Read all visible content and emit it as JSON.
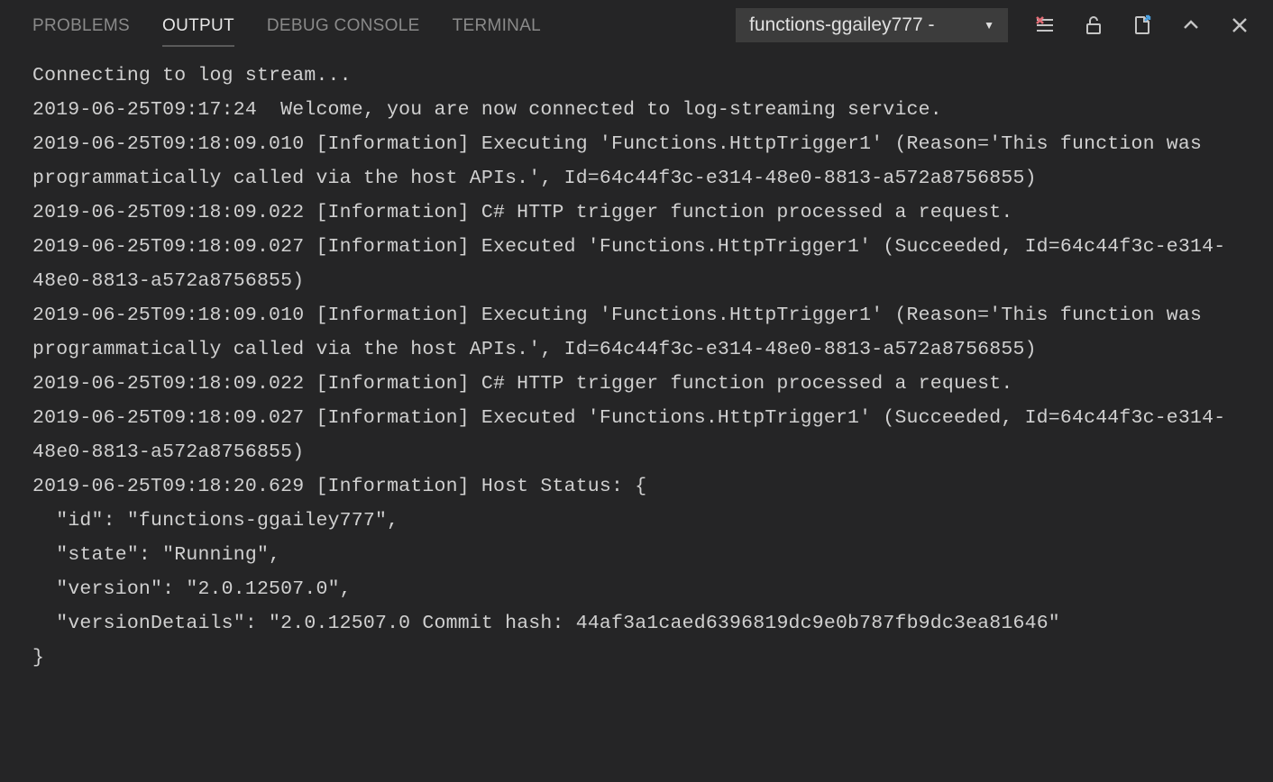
{
  "tabs": {
    "problems": "PROBLEMS",
    "output": "OUTPUT",
    "debug_console": "DEBUG CONSOLE",
    "terminal": "TERMINAL"
  },
  "dropdown": {
    "selected": "functions-ggailey777 -"
  },
  "log_lines": [
    "Connecting to log stream...",
    "2019-06-25T09:17:24  Welcome, you are now connected to log-streaming service.",
    "2019-06-25T09:18:09.010 [Information] Executing 'Functions.HttpTrigger1' (Reason='This function was programmatically called via the host APIs.', Id=64c44f3c-e314-48e0-8813-a572a8756855)",
    "2019-06-25T09:18:09.022 [Information] C# HTTP trigger function processed a request.",
    "2019-06-25T09:18:09.027 [Information] Executed 'Functions.HttpTrigger1' (Succeeded, Id=64c44f3c-e314-48e0-8813-a572a8756855)",
    "2019-06-25T09:18:09.010 [Information] Executing 'Functions.HttpTrigger1' (Reason='This function was programmatically called via the host APIs.', Id=64c44f3c-e314-48e0-8813-a572a8756855)",
    "2019-06-25T09:18:09.022 [Information] C# HTTP trigger function processed a request.",
    "2019-06-25T09:18:09.027 [Information] Executed 'Functions.HttpTrigger1' (Succeeded, Id=64c44f3c-e314-48e0-8813-a572a8756855)",
    "2019-06-25T09:18:20.629 [Information] Host Status: {",
    "  \"id\": \"functions-ggailey777\",",
    "  \"state\": \"Running\",",
    "  \"version\": \"2.0.12507.0\",",
    "  \"versionDetails\": \"2.0.12507.0 Commit hash: 44af3a1caed6396819dc9e0b787fb9dc3ea81646\"",
    "}"
  ]
}
